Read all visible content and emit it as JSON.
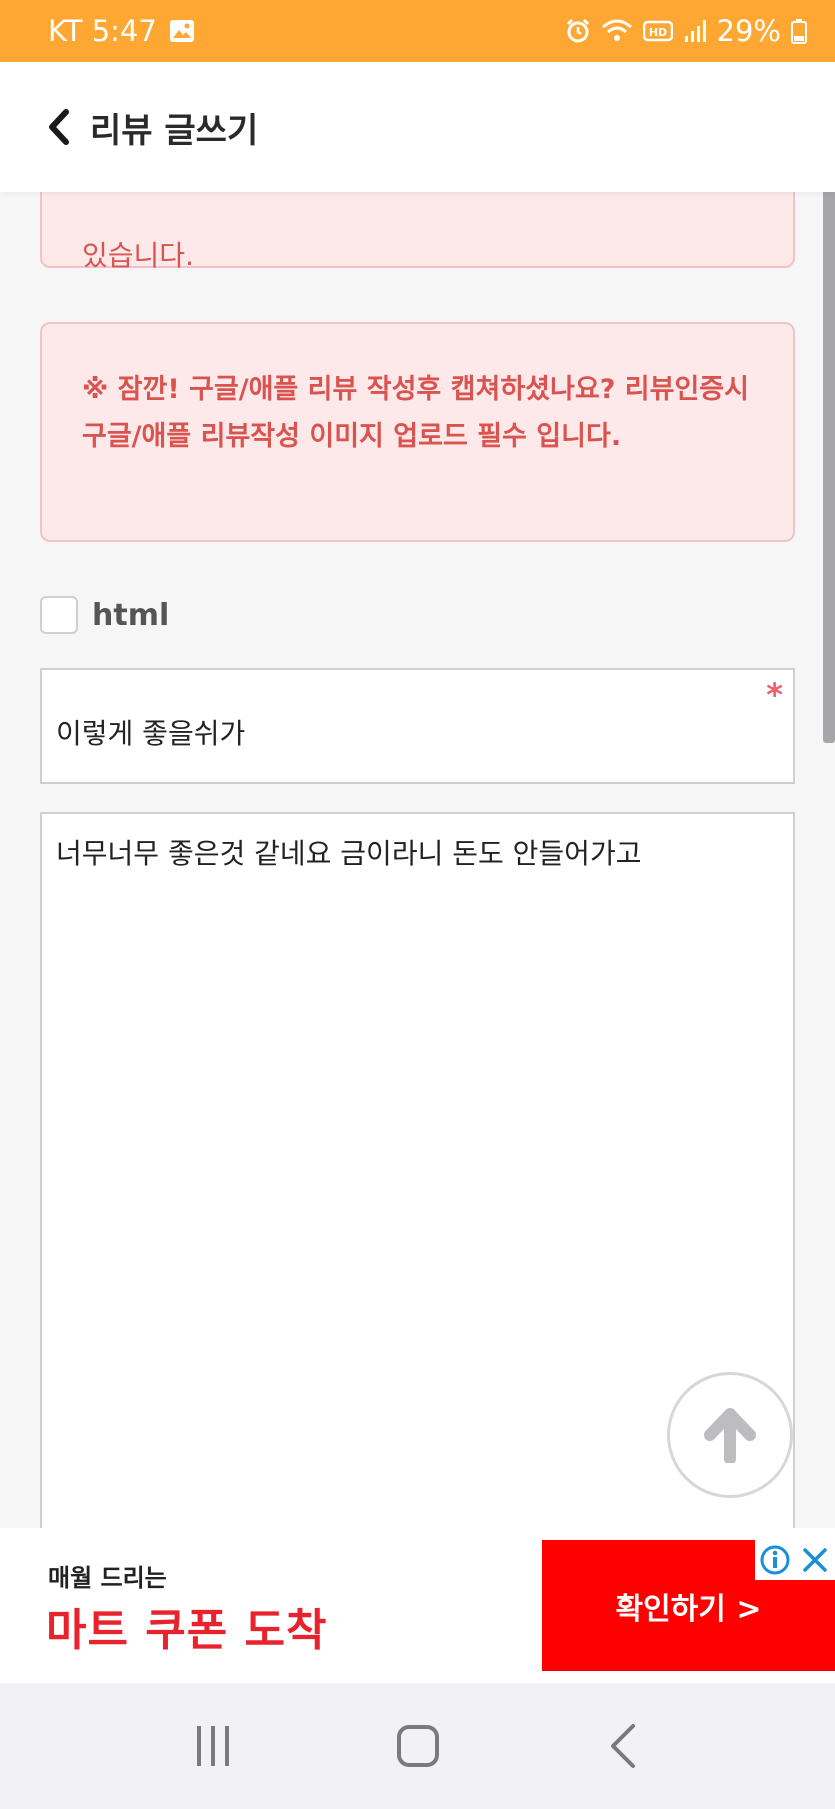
{
  "status_bar": {
    "carrier_time": "KT 5:47",
    "battery": "29%",
    "color": "#ffa733",
    "icons": [
      "image-icon",
      "alarm-icon",
      "wifi-icon",
      "hd-icon",
      "signal-icon",
      "battery-icon"
    ]
  },
  "header": {
    "title": "리뷰 글쓰기"
  },
  "alerts": {
    "top_text": "있습니다.",
    "main_text": "※ 잠깐! 구글/애플 리뷰 작성후 캡쳐하셨나요? 리뷰인증시 구글/애플 리뷰작성 이미지 업로드 필수 입니다."
  },
  "form": {
    "html_label": "html",
    "title_value": "이렇게 좋을쉬가",
    "required_mark": "*",
    "body_value": "너무너무 좋은것 같네요 금이라니 돈도 안들어가고"
  },
  "ad": {
    "subtitle": "매월 드리는",
    "headline": "마트 쿠폰 도착",
    "cta": "확인하기 >",
    "cta_color": "#ff0000"
  },
  "colors": {
    "alert_bg": "#fde9ea",
    "alert_text": "#d9534f"
  }
}
